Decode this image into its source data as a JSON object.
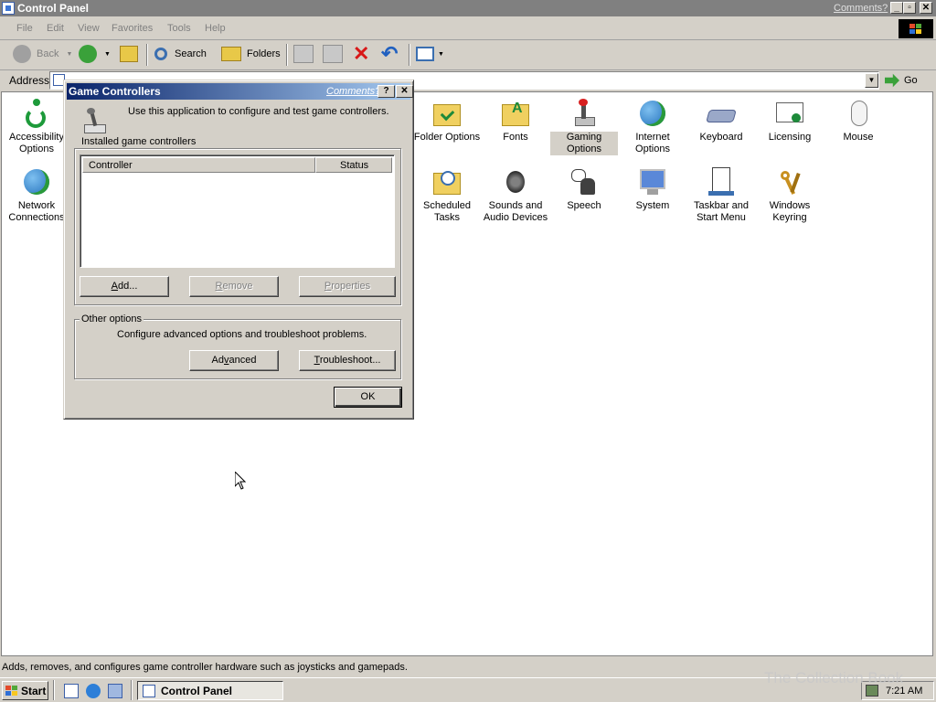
{
  "window": {
    "title": "Control Panel",
    "comments_link": "Comments?"
  },
  "menu": [
    "File",
    "Edit",
    "View",
    "Favorites",
    "Tools",
    "Help"
  ],
  "toolbar": {
    "back": "Back",
    "search": "Search",
    "folders": "Folders"
  },
  "address": {
    "label": "Address",
    "go": "Go"
  },
  "control_panel_items": [
    {
      "label": "Accessibility Options",
      "icon": "accessibility-icon"
    },
    {
      "label": "Network Connections",
      "icon": "network-icon"
    },
    {
      "label": "Folder Options",
      "icon": "folder-options-icon"
    },
    {
      "label": "Fonts",
      "icon": "fonts-icon"
    },
    {
      "label": "Gaming Options",
      "icon": "joystick-icon"
    },
    {
      "label": "Internet Options",
      "icon": "internet-icon"
    },
    {
      "label": "Keyboard",
      "icon": "keyboard-icon"
    },
    {
      "label": "Licensing",
      "icon": "licensing-icon"
    },
    {
      "label": "Mouse",
      "icon": "mouse-icon"
    },
    {
      "label": "Scheduled Tasks",
      "icon": "scheduled-tasks-icon"
    },
    {
      "label": "Sounds and Audio Devices",
      "icon": "speaker-icon"
    },
    {
      "label": "Speech",
      "icon": "speech-icon"
    },
    {
      "label": "System",
      "icon": "system-icon"
    },
    {
      "label": "Taskbar and Start Menu",
      "icon": "taskbar-icon"
    },
    {
      "label": "Windows Keyring",
      "icon": "keyring-icon"
    }
  ],
  "status_text": "Adds, removes, and configures game controller hardware such as joysticks and gamepads.",
  "dialog": {
    "title": "Game Controllers",
    "comments_link": "Comments?",
    "help_btn": "?",
    "close_btn": "✕",
    "intro": "Use this application to configure and test game controllers.",
    "installed_group": "Installed game controllers",
    "col_controller": "Controller",
    "col_status": "Status",
    "add_btn": "Add...",
    "remove_btn": "Remove",
    "properties_btn": "Properties",
    "other_group": "Other options",
    "other_text": "Configure advanced options and troubleshoot problems.",
    "advanced_btn": "Advanced",
    "troubleshoot_btn": "Troubleshoot...",
    "ok_btn": "OK"
  },
  "taskbar": {
    "start": "Start",
    "task_control_panel": "Control Panel",
    "clock": "7:21 AM"
  },
  "watermark": "The Collection Book"
}
